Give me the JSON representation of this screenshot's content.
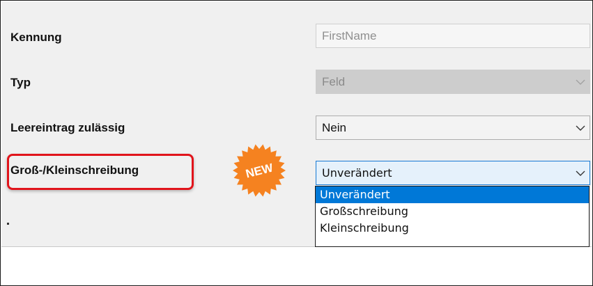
{
  "form": {
    "kennung": {
      "label": "Kennung",
      "value": "FirstName"
    },
    "typ": {
      "label": "Typ",
      "value": "Feld"
    },
    "leereintrag": {
      "label": "Leereintrag zulässig",
      "value": "Nein"
    },
    "schreibung": {
      "label": "Groß-/Kleinschreibung",
      "value": "Unverändert",
      "options": [
        "Unverändert",
        "Großschreibung",
        "Kleinschreibung"
      ],
      "selected_index": 0
    }
  },
  "badge": {
    "text": "NEW",
    "color": "#f58220"
  },
  "colors": {
    "highlight": "#e1141b",
    "selection": "#0078d7",
    "focus_border": "#1679d4"
  }
}
